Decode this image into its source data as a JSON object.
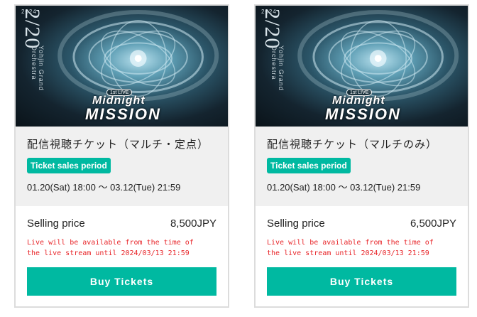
{
  "cards": [
    {
      "artwork": {
        "date_text": "2/20",
        "year_text": "2024",
        "ensemble_text": "Yohjin Grand Orchestra",
        "live_badge": "1st LIVE",
        "logo_line1": "Midnight",
        "logo_line2": "MISSION"
      },
      "title": "配信視聴チケット（マルチ・定点）",
      "period_badge": "Ticket sales period",
      "period": "01.20(Sat) 18:00 〜 03.12(Tue) 21:59",
      "price_label": "Selling price",
      "price": "8,500JPY",
      "note_line1": "Live will be available from the time of",
      "note_line2": "the live stream until 2024/03/13 21:59",
      "buy_label": "Buy Tickets"
    },
    {
      "artwork": {
        "date_text": "2/20",
        "year_text": "2024",
        "ensemble_text": "Yohjin Grand Orchestra",
        "live_badge": "1st LIVE",
        "logo_line1": "Midnight",
        "logo_line2": "MISSION"
      },
      "title": "配信視聴チケット（マルチのみ）",
      "period_badge": "Ticket sales period",
      "period": "01.20(Sat) 18:00 〜 03.12(Tue) 21:59",
      "price_label": "Selling price",
      "price": "6,500JPY",
      "note_line1": "Live will be available from the time of",
      "note_line2": "the live stream until 2024/03/13 21:59",
      "buy_label": "Buy Tickets"
    }
  ],
  "colors": {
    "accent": "#00b9a1",
    "warning_text": "#e8262a",
    "info_background": "#f0f0f0",
    "card_border": "#dcdcdc"
  }
}
